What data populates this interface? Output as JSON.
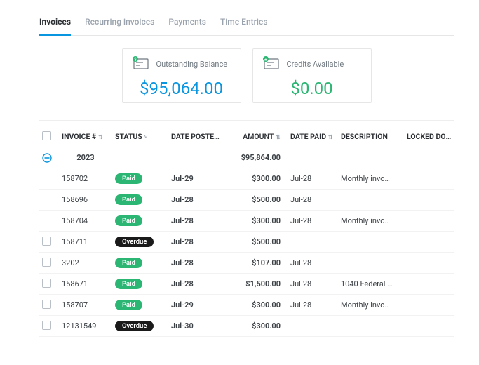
{
  "tabs": {
    "invoices": "Invoices",
    "recurring": "Recurring invoices",
    "payments": "Payments",
    "time": "Time Entries"
  },
  "cards": {
    "balance": {
      "label": "Outstanding Balance",
      "value": "$95,064.00"
    },
    "credits": {
      "label": "Credits Available",
      "value": "$0.00"
    }
  },
  "table": {
    "headers": {
      "invoice": "INVOICE #",
      "status": "STATUS",
      "date_posted": "DATE POSTE…",
      "amount": "AMOUNT",
      "date_paid": "DATE PAID",
      "description": "DESCRIPTION",
      "locked": "LOCKED DOCS"
    },
    "group": {
      "year": "2023",
      "total": "$95,864.00"
    },
    "rows": [
      {
        "checkbox": false,
        "invoice": "158702",
        "status": "Paid",
        "status_kind": "paid",
        "date_posted": "Jul-29",
        "amount": "$300.00",
        "date_paid": "Jul-28",
        "description": "Monthly invo…"
      },
      {
        "checkbox": false,
        "invoice": "158696",
        "status": "Paid",
        "status_kind": "paid",
        "date_posted": "Jul-28",
        "amount": "$500.00",
        "date_paid": "Jul-28",
        "description": ""
      },
      {
        "checkbox": false,
        "invoice": "158704",
        "status": "Paid",
        "status_kind": "paid",
        "date_posted": "Jul-28",
        "amount": "$300.00",
        "date_paid": "Jul-28",
        "description": "Monthly invo…"
      },
      {
        "checkbox": true,
        "invoice": "158711",
        "status": "Overdue",
        "status_kind": "overdue",
        "date_posted": "Jul-28",
        "amount": "$500.00",
        "date_paid": "",
        "description": ""
      },
      {
        "checkbox": true,
        "invoice": "3202",
        "status": "Paid",
        "status_kind": "paid",
        "date_posted": "Jul-28",
        "amount": "$107.00",
        "date_paid": "Jul-28",
        "description": ""
      },
      {
        "checkbox": true,
        "invoice": "158671",
        "status": "Paid",
        "status_kind": "paid",
        "date_posted": "Jul-28",
        "amount": "$1,500.00",
        "date_paid": "Jul-28",
        "description": "1040 Federal …"
      },
      {
        "checkbox": true,
        "invoice": "158707",
        "status": "Paid",
        "status_kind": "paid",
        "date_posted": "Jul-29",
        "amount": "$300.00",
        "date_paid": "Jul-28",
        "description": "Monthly invo…"
      },
      {
        "checkbox": true,
        "invoice": "12131549",
        "status": "Overdue",
        "status_kind": "overdue",
        "date_posted": "Jul-30",
        "amount": "$300.00",
        "date_paid": "",
        "description": ""
      }
    ]
  }
}
